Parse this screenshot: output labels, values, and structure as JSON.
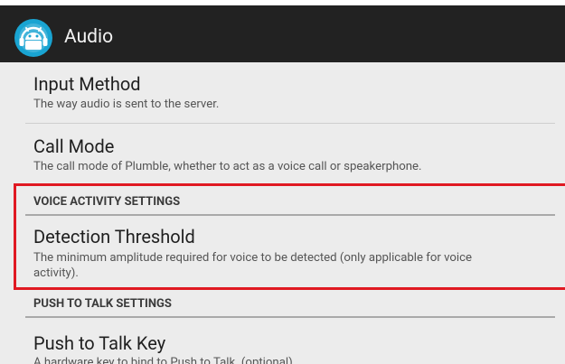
{
  "action_bar": {
    "title": "Audio",
    "icon": "android-headset-icon",
    "background": "#222222"
  },
  "preferences": {
    "input_method": {
      "title": "Input Method",
      "summary": "The way audio is sent to the server."
    },
    "call_mode": {
      "title": "Call Mode",
      "summary": "The call mode of Plumble, whether to act as a voice call or speakerphone."
    },
    "voice_activity_category": "VOICE ACTIVITY SETTINGS",
    "detection_threshold": {
      "title": "Detection Threshold",
      "summary_line1": "The minimum amplitude required for voice to be detected (only applicable for voice",
      "summary_line2": "activity)."
    },
    "push_to_talk_category": "PUSH TO TALK SETTINGS",
    "push_to_talk_key": {
      "title": "Push to Talk Key",
      "summary": "A hardware key to bind to Push to Talk. (optional)"
    }
  },
  "colors": {
    "highlight": "#e01922",
    "background": "#ececec"
  }
}
